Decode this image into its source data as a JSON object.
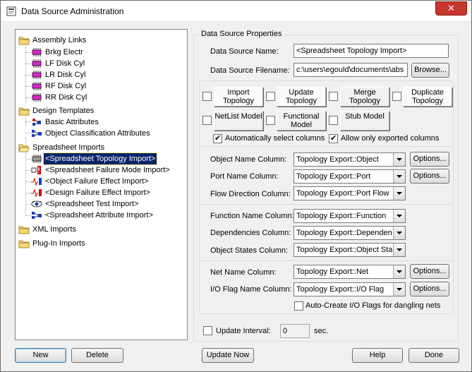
{
  "window": {
    "title": "Data Source Administration",
    "close_glyph": "✕"
  },
  "tree": {
    "nodes": [
      {
        "label": "Assembly Links",
        "icon": "folder-icon"
      },
      {
        "label": "Brkg Electr",
        "icon": "chip-icon"
      },
      {
        "label": "LF Disk Cyl",
        "icon": "chip-icon"
      },
      {
        "label": "LR Disk Cyl",
        "icon": "chip-icon"
      },
      {
        "label": "RF Disk Cyl",
        "icon": "chip-icon"
      },
      {
        "label": "RR Disk Cyl",
        "icon": "chip-icon"
      },
      {
        "label": "Design Templates",
        "icon": "folder-icon"
      },
      {
        "label": "Basic Attributes",
        "icon": "attributes-icon"
      },
      {
        "label": "Object Classification Attributes",
        "icon": "attributes-icon"
      },
      {
        "label": "Spreadsheet Imports",
        "icon": "folder-icon"
      },
      {
        "label": "<Spreadsheet Topology Import>",
        "icon": "topology-icon"
      },
      {
        "label": "<Spreadsheet Failure Mode Import>",
        "icon": "failure-mode-icon"
      },
      {
        "label": "<Object Failure Effect Import>",
        "icon": "failure-effect-icon"
      },
      {
        "label": "<Design Failure Effect Import>",
        "icon": "failure-effect-icon"
      },
      {
        "label": "<Spreadsheet Test Import>",
        "icon": "eye-icon"
      },
      {
        "label": "<Spreadsheet Attribute Import>",
        "icon": "attributes-icon"
      },
      {
        "label": "XML Imports",
        "icon": "folder-icon"
      },
      {
        "label": "Plug-In Imports",
        "icon": "folder-icon"
      }
    ],
    "selected_index": 10
  },
  "properties": {
    "group_title": "Data Source Properties",
    "name_label": "Data Source Name:",
    "name_value": "<Spreadsheet Topology Import>",
    "filename_label": "Data Source Filename:",
    "filename_value": "c:\\users\\egould\\documents\\abs",
    "browse_label": "Browse..."
  },
  "toggles": [
    {
      "label": "Import Topology",
      "checked": false,
      "pressed": true
    },
    {
      "label": "Update Topology",
      "checked": false,
      "pressed": true
    },
    {
      "label": "Merge Topology",
      "checked": false,
      "pressed": false
    },
    {
      "label": "Duplicate Topology",
      "checked": false,
      "pressed": true
    },
    {
      "label": "NetList Model",
      "checked": false,
      "pressed": false
    },
    {
      "label": "Functional Model",
      "checked": false,
      "pressed": false
    },
    {
      "label": "Stub Model",
      "checked": false,
      "pressed": false
    }
  ],
  "options": {
    "auto_select_label": "Automatically select columns",
    "auto_select_checked": true,
    "exported_only_label": "Allow only exported columns",
    "exported_only_checked": true
  },
  "columns": {
    "object_name_label": "Object Name Column:",
    "object_name_value": "Topology Export::Object",
    "port_name_label": "Port Name Column:",
    "port_name_value": "Topology Export::Port",
    "flow_direction_label": "Flow Direction Column:",
    "flow_direction_value": "Topology Export::Port Flow",
    "function_name_label": "Function Name Column:",
    "function_name_value": "Topology Export::Function",
    "dependencies_label": "Dependencies Column:",
    "dependencies_value": "Topology Export::Dependenc",
    "object_states_label": "Object States Column:",
    "object_states_value": "Topology Export::Object Stat",
    "net_name_label": "Net Name Column:",
    "net_name_value": "Topology Export::Net",
    "io_flag_label": "I/O Flag Name Column:",
    "io_flag_value": "Topology Export::I/O Flag",
    "options_label": "Options...",
    "auto_create_label": "Auto-Create I/O Flags for dangling nets",
    "auto_create_checked": false
  },
  "update": {
    "interval_label": "Update Interval:",
    "interval_value": "0",
    "unit_label": "sec.",
    "checked": false
  },
  "footer": {
    "new_label": "New",
    "delete_label": "Delete",
    "update_now_label": "Update Now",
    "help_label": "Help",
    "done_label": "Done"
  }
}
